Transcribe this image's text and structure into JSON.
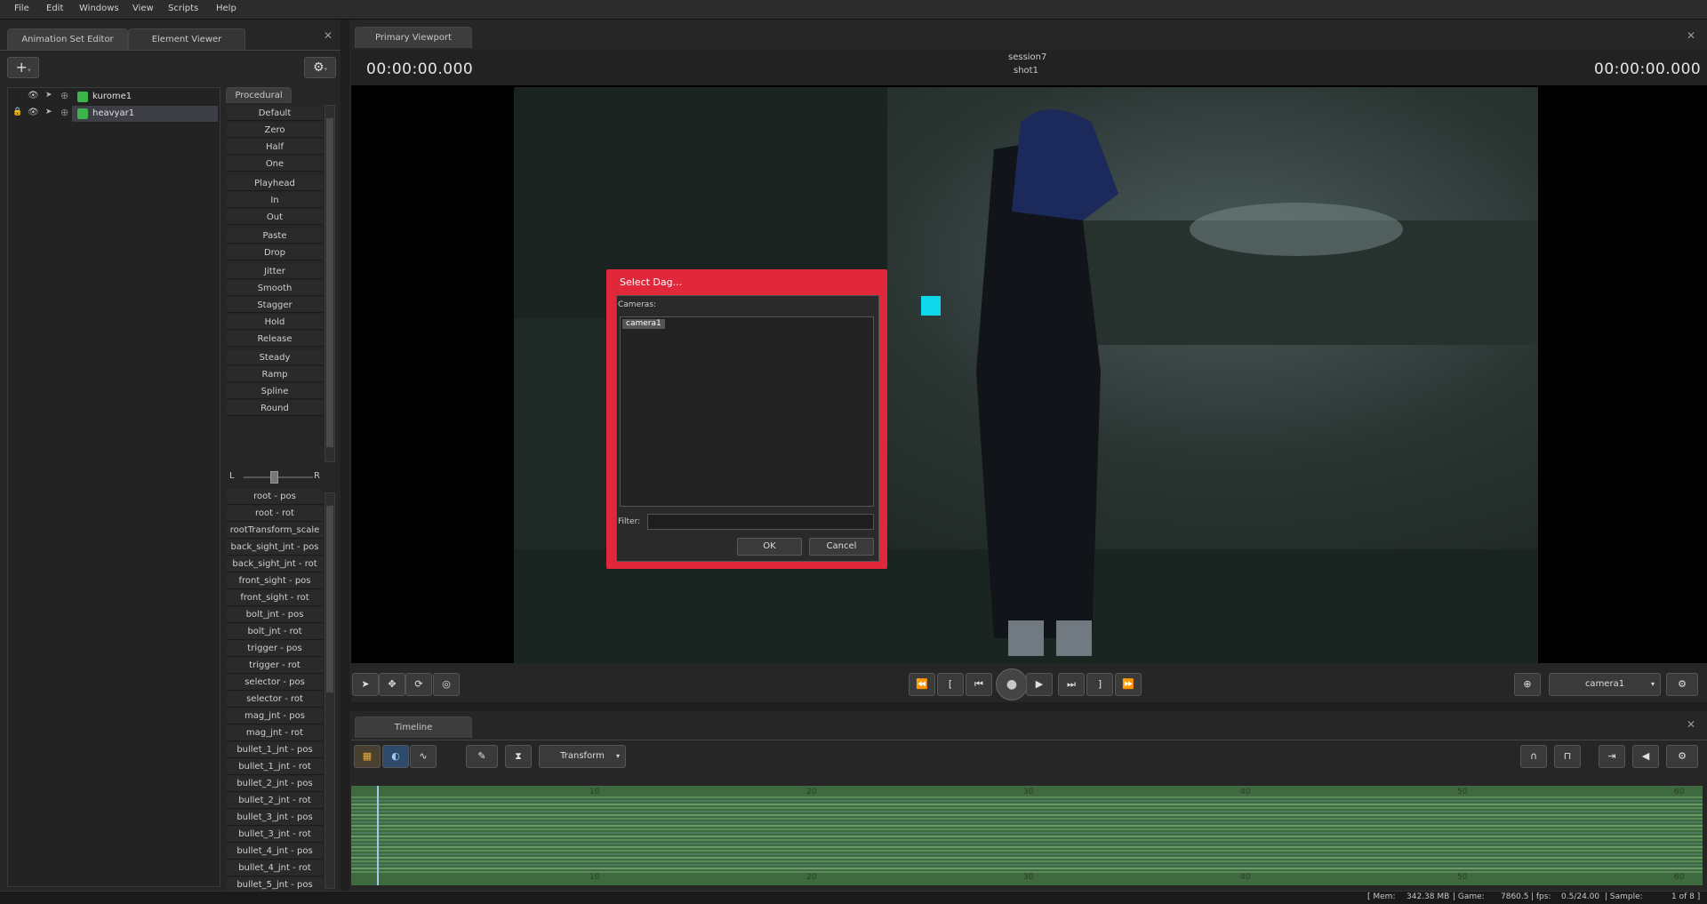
{
  "menu": [
    "File",
    "Edit",
    "Windows",
    "View",
    "Scripts",
    "Help"
  ],
  "left_panel": {
    "tabs": [
      "Animation Set Editor",
      "Element Viewer"
    ],
    "tree": [
      {
        "label": "kurome1",
        "selected": false,
        "locked": false
      },
      {
        "label": "heavyar1",
        "selected": true,
        "locked": true
      }
    ]
  },
  "procedural": {
    "tab": "Procedural",
    "buttons": [
      "Default",
      "Zero",
      "Half",
      "One",
      "Playhead",
      "In",
      "Out",
      "Paste",
      "Drop",
      "Jitter",
      "Smooth",
      "Stagger",
      "Hold",
      "Release",
      "Steady",
      "Ramp",
      "Spline",
      "Round"
    ],
    "balance_left": "L",
    "balance_right": "R",
    "controls": [
      "root - pos",
      "root - rot",
      "rootTransform_scale",
      "back_sight_jnt - pos",
      "back_sight_jnt - rot",
      "front_sight - pos",
      "front_sight - rot",
      "bolt_jnt - pos",
      "bolt_jnt - rot",
      "trigger - pos",
      "trigger - rot",
      "selector - pos",
      "selector - rot",
      "mag_jnt - pos",
      "mag_jnt - rot",
      "bullet_1_jnt - pos",
      "bullet_1_jnt - rot",
      "bullet_2_jnt - pos",
      "bullet_2_jnt - rot",
      "bullet_3_jnt - pos",
      "bullet_3_jnt - rot",
      "bullet_4_jnt - pos",
      "bullet_4_jnt - rot",
      "bullet_5_jnt - pos"
    ]
  },
  "viewport": {
    "tab": "Primary Viewport",
    "time_left": "00:00:00.000",
    "time_right": "00:00:00.000",
    "session": "session7",
    "shot": "shot1",
    "camera_select": "camera1"
  },
  "dialog": {
    "title": "Select Dag...",
    "cameras_label": "Cameras:",
    "items": [
      "camera1"
    ],
    "filter_label": "Filter:",
    "filter_value": "",
    "ok": "OK",
    "cancel": "Cancel"
  },
  "timeline": {
    "tab": "Timeline",
    "mode_select": "Transform",
    "ticks": [
      "10",
      "20",
      "30",
      "40",
      "50",
      "60"
    ]
  },
  "status": {
    "mem": "[ Mem:",
    "mem_value": "342.38 MB",
    "game": "| Game:",
    "game_value": "7860.5",
    "fps": "| fps:",
    "fps_value": "0.5/24.00",
    "sample": "| Sample:",
    "sample_value": "1 of 8 ]"
  },
  "colors": {
    "dialog_border": "#e0283a",
    "timeline_track": "#3f6a3f",
    "selection": "#3e3e46"
  }
}
